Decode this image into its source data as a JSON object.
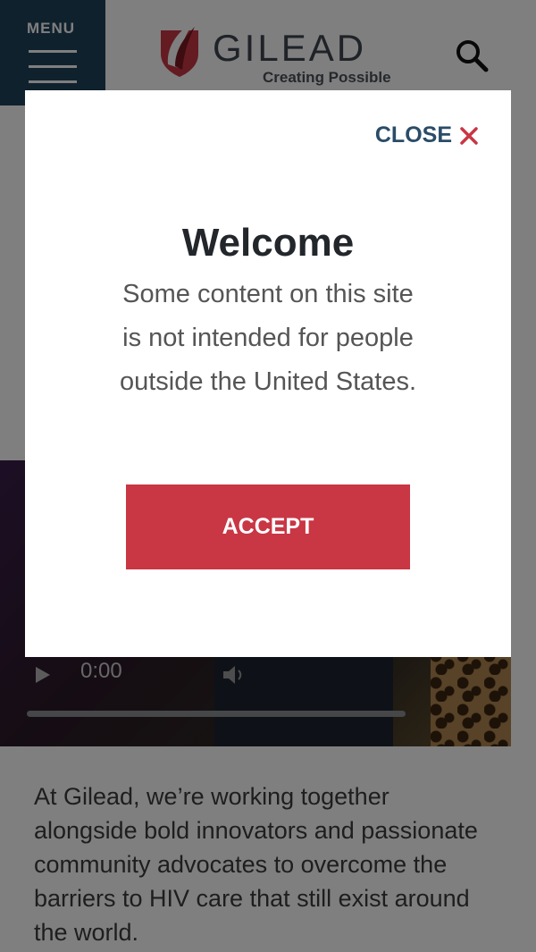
{
  "header": {
    "menu_label": "MENU",
    "logo_name": "GILEAD",
    "logo_tagline": "Creating Possible",
    "search_icon": "search-icon",
    "menu_icon": "hamburger-icon"
  },
  "video": {
    "time": "0:00",
    "play_icon": "play-icon",
    "volume_icon": "volume-icon"
  },
  "body_text": "At Gilead, we’re working together alongside bold innovators and passionate community advocates to overcome the barriers to HIV care that still exist around the world.",
  "modal": {
    "close_label": "CLOSE",
    "close_icon": "close-icon",
    "title": "Welcome",
    "message": "Some content on this site is not intended for people outside the United States.",
    "accept_label": "ACCEPT"
  },
  "colors": {
    "brand_navy": "#21435d",
    "accent_red": "#c93644",
    "overlay": "rgba(0,0,0,0.5)"
  }
}
